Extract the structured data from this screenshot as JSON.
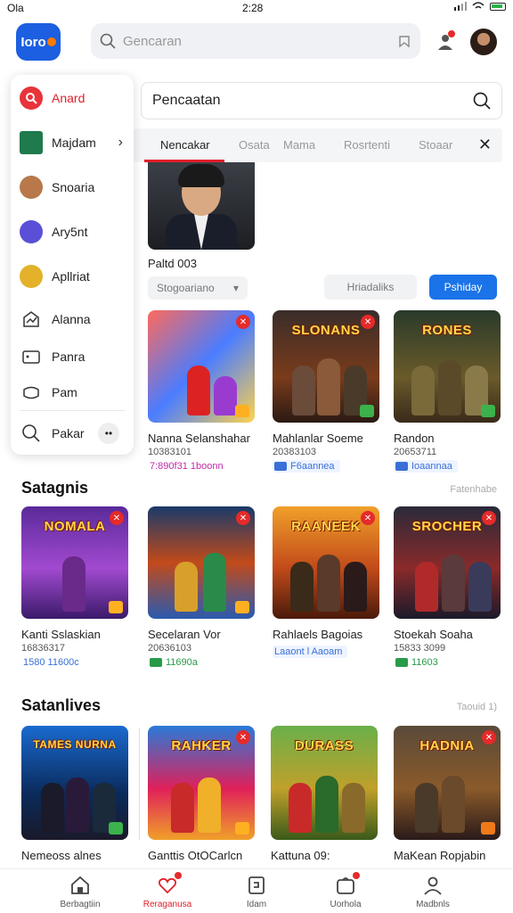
{
  "status_bar": {
    "left": "Ola",
    "time": "2:28"
  },
  "header": {
    "logo": "Ioro",
    "search_placeholder": "Gencaran"
  },
  "side_menu": {
    "items": [
      {
        "label": "Anard",
        "active": true
      },
      {
        "label": "Majdam",
        "has_arrow": true
      },
      {
        "label": "Snoaria"
      },
      {
        "label": "Ary5nt"
      },
      {
        "label": "Apllriat"
      },
      {
        "label": "Alanna"
      },
      {
        "label": "Panra"
      },
      {
        "label": "Pam"
      },
      {
        "label": "Pakar"
      }
    ]
  },
  "search_panel": {
    "value": "Pencaatan",
    "tabs": [
      "Nencakar",
      "Osata",
      "Mama",
      "Rosrtenti",
      "Stoaar"
    ]
  },
  "featured": {
    "title": "Paltd 003",
    "filter_left": "Stogoariano",
    "filter_mid": "Hriadaliks",
    "filter_button": "Pshiday"
  },
  "row1": [
    {
      "name": "Nanna Selanshahar",
      "sub": "10383101",
      "badge": "7:890f31 1boonn",
      "art": "ctch"
    },
    {
      "name": "Mahlanlar Soeme",
      "sub": "20383103",
      "badge": "F6aannea",
      "art": "SLONANS"
    },
    {
      "name": "Randon",
      "sub": "20653711",
      "badge": "Ioaannaa",
      "art": "RONES"
    }
  ],
  "section2": {
    "title": "Satagnis",
    "link": "Fatenhabe"
  },
  "row2": [
    {
      "name": "Kanti Sslaskian",
      "sub": "16836317",
      "badge": "1580 11600c",
      "art": "NOMALA"
    },
    {
      "name": "Secelaran Vor",
      "sub": "20636103",
      "badge": "11690a",
      "art": "ctch"
    },
    {
      "name": "Rahlaels Bagoias",
      "sub": "",
      "badge": "Laaont l Aaoam",
      "art": "RAANEEK"
    },
    {
      "name": "Stoekah Soaha",
      "sub": "15833 3099",
      "badge": "11603",
      "art": "SROCHER"
    }
  ],
  "section3": {
    "title": "Satanlives",
    "link": "Taouid 1)"
  },
  "row3": [
    {
      "name": "Nemeoss alnes",
      "art": "TAMES NURNA"
    },
    {
      "name": "Ganttis OtOCarlcn",
      "art": "RAHKER"
    },
    {
      "name": "Kattuna 09:",
      "art": "DURASS"
    },
    {
      "name": "MaKean Ropjabin",
      "art": "HADNIA"
    }
  ],
  "bottom_nav": [
    {
      "label": "Berbagtiin",
      "active": false
    },
    {
      "label": "Reraganusa",
      "active": true,
      "dot": true
    },
    {
      "label": "Idam",
      "active": false
    },
    {
      "label": "Uorhola",
      "active": false,
      "dot": true
    },
    {
      "label": "Madbnls",
      "active": false
    }
  ],
  "colors": {
    "accent": "#e0202a",
    "primary_blue": "#1a73e8",
    "logo_blue": "#1c5fe0",
    "logo_dot": "#ff7a00"
  }
}
